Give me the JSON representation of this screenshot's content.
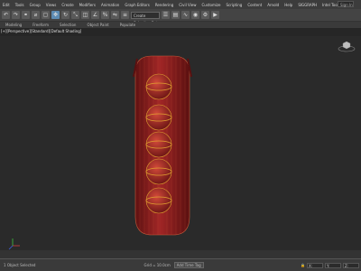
{
  "menu": {
    "items": [
      "Edit",
      "Tools",
      "Group",
      "Views",
      "Create",
      "Modifiers",
      "Animation",
      "Graph Editors",
      "Rendering",
      "Civil View",
      "Customize",
      "Scripting",
      "Content",
      "Arnold",
      "Help",
      "SIGGRAPH",
      "Intel Tools"
    ],
    "search": "Sign In"
  },
  "toolbar": {
    "selection_filter": "Create Selection Set"
  },
  "ribbon": {
    "tabs": [
      "Modeling",
      "Freeform",
      "Selection",
      "Object Paint",
      "Populate"
    ]
  },
  "viewport": {
    "label": "[+][Perspective][Standard][Default Shading]",
    "model_colors": {
      "body": "#8a1e1e",
      "wire": "#c85a3a",
      "gizmo": "#e0a030"
    },
    "spheres": 5
  },
  "status": {
    "left": "1 Object Selected",
    "grid": "Grid = 10.0cm",
    "add_time_tag": "Add Time Tag",
    "coords": [
      "X:",
      "Y:",
      "Z:"
    ]
  }
}
